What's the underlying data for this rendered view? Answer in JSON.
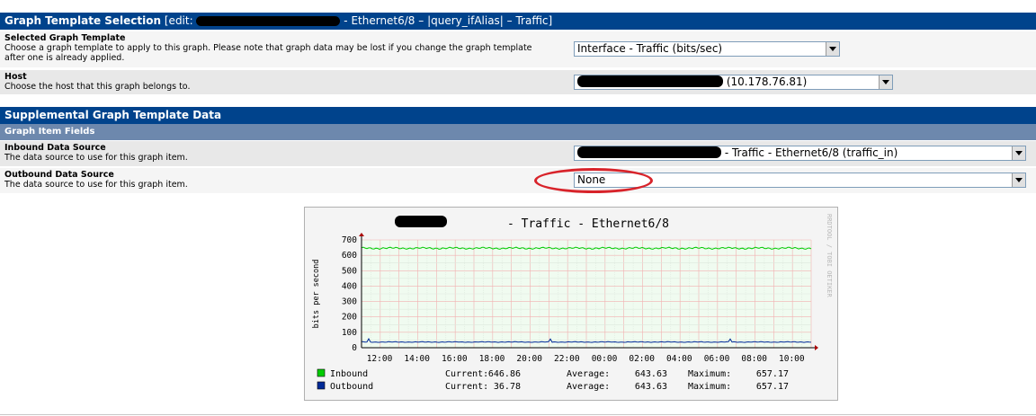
{
  "section1": {
    "title_bold": "Graph Template Selection",
    "title_edit": "[edit:",
    "title_rest": "- Ethernet6/8 – |query_ifAlias| – Traffic]"
  },
  "selected_template": {
    "label": "Selected Graph Template",
    "desc": "Choose a graph template to apply to this graph. Please note that graph data may be lost if you change the graph template after one is already applied.",
    "value": "Interface - Traffic (bits/sec)"
  },
  "host": {
    "label": "Host",
    "desc": "Choose the host that this graph belongs to.",
    "value": "(10.178.76.81)"
  },
  "section2": {
    "title": "Supplemental Graph Template Data",
    "subheader": "Graph Item Fields"
  },
  "inbound": {
    "label": "Inbound Data Source",
    "desc": "The data source to use for this graph item.",
    "value": "- Traffic - Ethernet6/8 (traffic_in)"
  },
  "outbound": {
    "label": "Outbound Data Source",
    "desc": "The data source to use for this graph item.",
    "value": "None"
  },
  "chart_data": {
    "type": "line",
    "title": "- Traffic - Ethernet6/8",
    "ylabel": "bits per second",
    "watermark": "RRDTOOL / TOBI OETIKER",
    "ylim": [
      0,
      700
    ],
    "yticks": [
      "0",
      "100",
      "200",
      "300",
      "400",
      "500",
      "600",
      "700"
    ],
    "xticks": [
      "12:00",
      "14:00",
      "16:00",
      "18:00",
      "20:00",
      "22:00",
      "00:00",
      "02:00",
      "04:00",
      "06:00",
      "08:00",
      "10:00"
    ],
    "grid": true,
    "series": [
      {
        "name": "Inbound",
        "color": "#00cc00",
        "value": 646,
        "current": "646.86",
        "average": "643.63",
        "maximum": "657.17"
      },
      {
        "name": "Outbound",
        "color": "#002a97",
        "value": 37,
        "current": "36.78",
        "average": "643.63",
        "maximum": "657.17"
      }
    ],
    "legend_labels": {
      "current": "Current:",
      "average": "Average:",
      "maximum": "Maximum:"
    }
  }
}
